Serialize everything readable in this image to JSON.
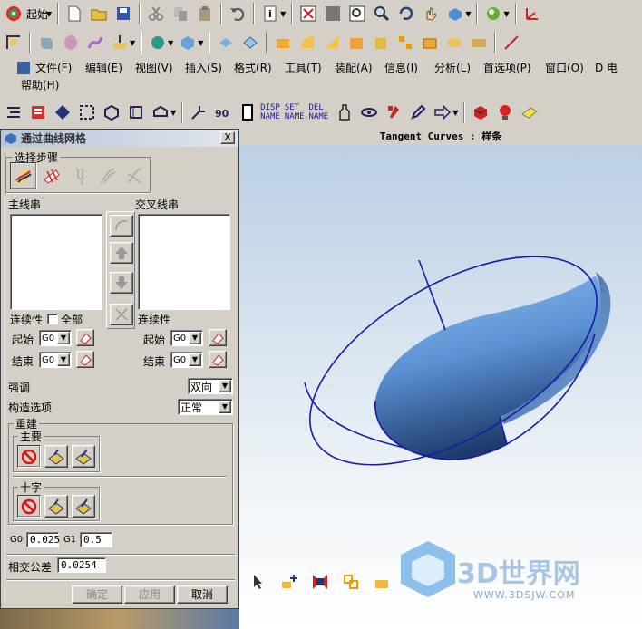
{
  "toolbar_row1": {
    "start_label": "起始"
  },
  "menu": [
    "文件(F)",
    "编辑(E)",
    "视图(V)",
    "插入(S)",
    "格式(R)",
    "工具(T)",
    "装配(A)",
    "信息(I)",
    "分析(L)",
    "首选项(P)",
    "窗口(O)",
    "D 电",
    "帮助(H)"
  ],
  "toolbar_row3": {
    "disp_name": "DISP\nNAME",
    "set_name": "SET\nNAME",
    "del_name": "DEL\nNAME"
  },
  "viewport": {
    "title": "Tangent Curves : 样条",
    "watermark": "3D世界网",
    "watermark_url": "WWW.3DSJW.COM"
  },
  "dialog": {
    "title": "通过曲线网格",
    "close": "X",
    "step_group": "选择步骤",
    "primary_label": "主线串",
    "cross_label": "交叉线串",
    "continuity": "连续性",
    "all_label": "全部",
    "start_label": "起始",
    "end_label": "结束",
    "primary_start": "G0",
    "primary_end": "G0",
    "cross_start": "G0",
    "cross_end": "G0",
    "emphasis_label": "强调",
    "emphasis_value": "双向",
    "construct_label": "构造选项",
    "construct_value": "正常",
    "rebuild_label": "重建",
    "main_label": "主要",
    "cross_sub_label": "十字",
    "g0_label": "G0",
    "g0_value": "0.025",
    "g1_label": "G1",
    "g1_value": "0.5",
    "tolerance_label": "相交公差",
    "tolerance_value": "0.0254",
    "ok": "确定",
    "apply": "应用",
    "cancel": "取消"
  },
  "colors": {
    "curve": "#1a1aa8",
    "surface": "#4f86c8",
    "accent": "#0a246a"
  }
}
